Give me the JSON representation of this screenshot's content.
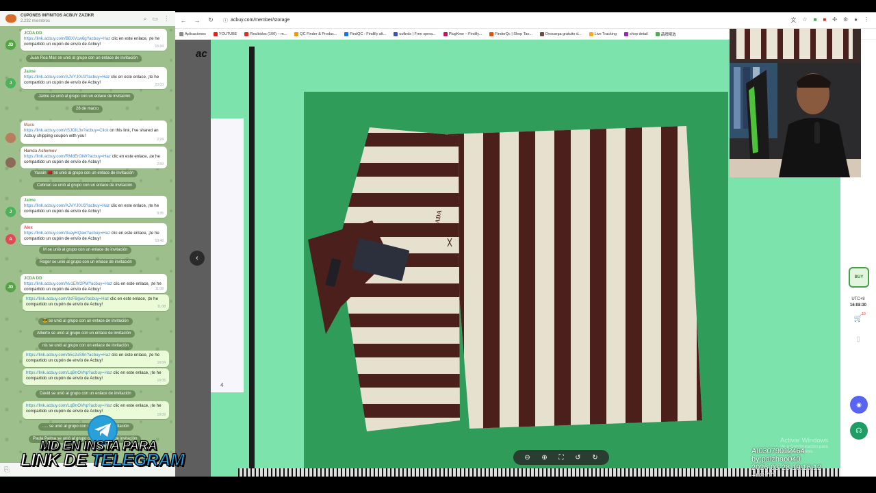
{
  "telegram": {
    "group_title": "CUPONES INFINITOS ACBUY ZAZIKR",
    "members": "2.232 miembros",
    "messages": [
      {
        "author": "JCDA DD",
        "initials": "JD",
        "color": "#53a543",
        "link": "https://link.acbuy.com/BBXVcw6g?acbuy=Haz",
        "text": "clic en este enlace, ¡te he compartido un cupón de envío de Acbuy!",
        "time": "15:34"
      },
      {
        "author": "Jaime",
        "initials": "J",
        "color": "#4cb35b",
        "link": "https://link.acbuy.com/AJVYJ0U3?acbuy=Haz",
        "text": "clic en este enlace, ¡te he compartido un cupón de envío de Acbuy!",
        "time": "23:03"
      },
      {
        "author": "Macu",
        "initials": "",
        "color": "#b77d5e",
        "link": "https://link.acbuy.com/rSJOIL3x?acbuy=Click",
        "text": "on this link, I've shared an Acbuy shipping coupon with you!",
        "time": "2:24"
      },
      {
        "author": "Hamza Ashemov",
        "initials": "",
        "color": "#8a6b5a",
        "link": "https://link.acbuy.com/RMdErOIW?acbuy=Haz",
        "text": "clic en este enlace, ¡te he compartido un cupón de envío de Acbuy!",
        "time": "2:59"
      },
      {
        "author": "Jaime",
        "initials": "J",
        "color": "#4cb35b",
        "link": "https://link.acbuy.com/AJVYJ0U3?acbuy=Haz",
        "text": "clic en este enlace, ¡te he compartido un cupón de envío de Acbuy!",
        "time": "9:35"
      },
      {
        "author": "Alex",
        "initials": "A",
        "color": "#e14a55",
        "link": "https://link.acbuy.com/3uayHQaw?acbuy=Haz",
        "text": "clic en este enlace, ¡te he compartido un cupón de envío de Acbuy!",
        "time": "10:48"
      },
      {
        "author": "JCDA DD",
        "initials": "JD",
        "color": "#53a543",
        "link": "https://link.acbuy.com/Nv1EW2PM?acbuy=Haz",
        "text": "clic en este enlace, ¡te he compartido un cupón de envío de Acbuy!",
        "time": "11:08"
      },
      {
        "author": "",
        "initials": "",
        "color": "",
        "link": "https://link.acbuy.com/3cFBgwu?acbuy=Haz",
        "text": "clic en este enlace, ¡te he compartido un cupón de envío de Acbuy!",
        "time": "11:08"
      },
      {
        "author": "",
        "initials": "",
        "color": "",
        "link": "https://link.acbuy.com/b5c2uS9n?acbuy=Haz",
        "text": "clic en este enlace, ¡te he compartido un cupón de envío de Acbuy!",
        "time": "16:04"
      },
      {
        "author": "",
        "initials": "",
        "color": "",
        "link": "https://link.acbuy.com/LqBnOVhp?acbuy=Haz",
        "text": "clic en este enlace, ¡te he compartido un cupón de envío de Acbuy!",
        "time": "16:05"
      },
      {
        "author": "",
        "initials": "",
        "color": "",
        "link": "https://link.acbuy.com/LqBnOVhp?acbuy=Haz",
        "text": "clic en este enlace, ¡te he compartido un cupón de envío de Acbuy!",
        "time": "16:09"
      }
    ],
    "system": [
      "Juan Roa Mas se unió al grupo con un enlace de invitación",
      "Jaime se unió al grupo con un enlace de invitación",
      "28 de marzo",
      "Yassin 🇲🇦 se unió al grupo con un enlace de invitación",
      "Cebrian se unió al grupo con un enlace de invitación",
      "M se unió al grupo con un enlace de invitación",
      "Roger se unió al grupo con un enlace de invitación",
      "😎 se unió al grupo con un enlace de invitación",
      "Alberto se unió al grupo con un enlace de invitación",
      "nis se unió al grupo con un enlace de invitación",
      "David se unió al grupo con un enlace de invitación",
      "..... se unió al grupo con un enlace de invitación",
      "Paula Palma se unió al grupo con un enlace de invitación"
    ]
  },
  "overlay": {
    "line1": "MD EN INSTA PARA",
    "line2a": "LINK DE ",
    "line2b": "TELEGRAM"
  },
  "browser": {
    "url": "acbuy.com/member/storage",
    "bookmarks": [
      {
        "label": "Aplicaciones",
        "color": "#888"
      },
      {
        "label": "YOUTUBE",
        "color": "#e62117"
      },
      {
        "label": "Recibidos (100) – m...",
        "color": "#d93025"
      },
      {
        "label": "QC Finder & Produc...",
        "color": "#f29900"
      },
      {
        "label": "FindQC - Findlily alt...",
        "color": "#1a73e8"
      },
      {
        "label": "uufinds | Free sprea...",
        "color": "#3f51b5"
      },
      {
        "label": "PlugKme – Findily...",
        "color": "#c2185b"
      },
      {
        "label": "FinderQc | Shop Tao...",
        "color": "#e65100"
      },
      {
        "label": "Descarga gratuito d...",
        "color": "#6d4c41"
      },
      {
        "label": "Live Tracking",
        "color": "#f9a825"
      },
      {
        "label": "shop detail",
        "color": "#9c27b0"
      },
      {
        "label": "品牌精选",
        "color": "#4caf50"
      }
    ],
    "brand": "ac",
    "rail": {
      "buy_label": "BUY",
      "time_label": "UTC+8",
      "time_value": "16:08:30",
      "cart_count": "10"
    }
  },
  "viewer": {
    "paper_number": "4",
    "stamp_id": "AI03079012464",
    "stamp_by": "by:paizhao040",
    "stamp_date": "2026-03-28 19:16:12 +08:00",
    "garment_label": "PRADA",
    "activate_title": "Activar Windows",
    "activate_sub": "Ve a Configuración para activar Windows."
  },
  "colors": {
    "stripe_dark": "#4a1f1c",
    "stripe_light": "#e6e1cf",
    "table_green": "#2f9c5a",
    "backdrop_green": "#7de3ac"
  }
}
